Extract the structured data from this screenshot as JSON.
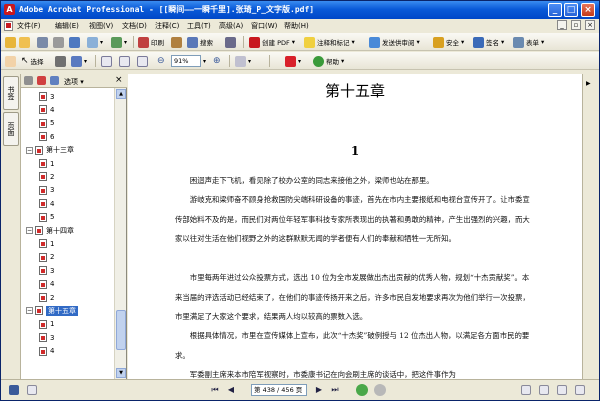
{
  "window": {
    "title": "Adobe Acrobat Professional - [[瞬间——一瞬千里].张琦_P_文字版.pdf]",
    "app_icon_label": "A"
  },
  "menu": {
    "items": [
      "文件(F)",
      "编辑(E)",
      "视图(V)",
      "文档(D)",
      "注释(C)",
      "工具(T)",
      "高级(A)",
      "窗口(W)",
      "帮助(H)"
    ]
  },
  "toolbar1": {
    "print_label": "印刷",
    "search_label": "搜索",
    "create_pdf_label": "创建 PDF",
    "comment_label": "注释和标记",
    "send_review_label": "发送供审阅",
    "secure_label": "安全",
    "sign_label": "签名",
    "forms_label": "表单"
  },
  "toolbar2": {
    "select_label": "选择",
    "zoom_value": "91%",
    "help_label": "帮助"
  },
  "side_tabs": [
    "书签",
    "页面"
  ],
  "bookmarks_panel": {
    "options_label": "选项",
    "close_glyph": "×",
    "tree": [
      {
        "level": 2,
        "label": "3"
      },
      {
        "level": 2,
        "label": "4"
      },
      {
        "level": 2,
        "label": "5"
      },
      {
        "level": 2,
        "label": "6"
      },
      {
        "level": 1,
        "label": "第十三章",
        "expanded": true
      },
      {
        "level": 2,
        "label": "1"
      },
      {
        "level": 2,
        "label": "2"
      },
      {
        "level": 2,
        "label": "3"
      },
      {
        "level": 2,
        "label": "4"
      },
      {
        "level": 2,
        "label": "5"
      },
      {
        "level": 1,
        "label": "第十四章",
        "expanded": true
      },
      {
        "level": 2,
        "label": "1"
      },
      {
        "level": 2,
        "label": "2"
      },
      {
        "level": 2,
        "label": "3"
      },
      {
        "level": 2,
        "label": "4"
      },
      {
        "level": 2,
        "label": "2"
      },
      {
        "level": 1,
        "label": "第十五章",
        "expanded": true,
        "selected": true
      },
      {
        "level": 2,
        "label": "1"
      },
      {
        "level": 2,
        "label": "3"
      },
      {
        "level": 2,
        "label": "4"
      }
    ]
  },
  "document": {
    "chapter_title": "第十五章",
    "section_number": "1",
    "paragraphs": [
      "困迴声走下飞机，看见除了校办公室的同志来接他之外，梁师也站在那里。",
      "游岐克和梁师奋不顾身抢救国防尖端科研设备的事迹，首先在市内主要报纸和电视台宣传开了。让市委宣传部始料不及的是，而民们对两位年轻军事科技专家所表现出的执著和勇敢的精神，产生出强烈的兴趣，而大家以往对生活在他们视野之外的这群默默无闻的学者便有人们的奉献和牺牲一无所知。",
      "市里每两年进过公众投票方式，选出 10 位为全市发展做出杰出贡献的优秀人物，规划“十杰贡献奖”。本来当届的评选活动已经结束了，在他们的事迹传扬开来之后，许多市民自发地要求再次为他们举行一次投票，市里满足了大家这个要求，结果两人均以较高的票数入选。",
      "根据具体情况，市里在宣传媒体上宣布，此次“十杰奖”破例授与 12 位杰出人物，以满足各方面市民的要求。",
      "军委副主席来本市陪军视察时，市委康书记在向会刷主席的谈话中，把这件事作为"
    ]
  },
  "status": {
    "page_display": "第 438 / 456 页"
  },
  "colors": {
    "titlebar": "#0a5ad8",
    "selection": "#316ac5",
    "chrome": "#ece9d8"
  }
}
